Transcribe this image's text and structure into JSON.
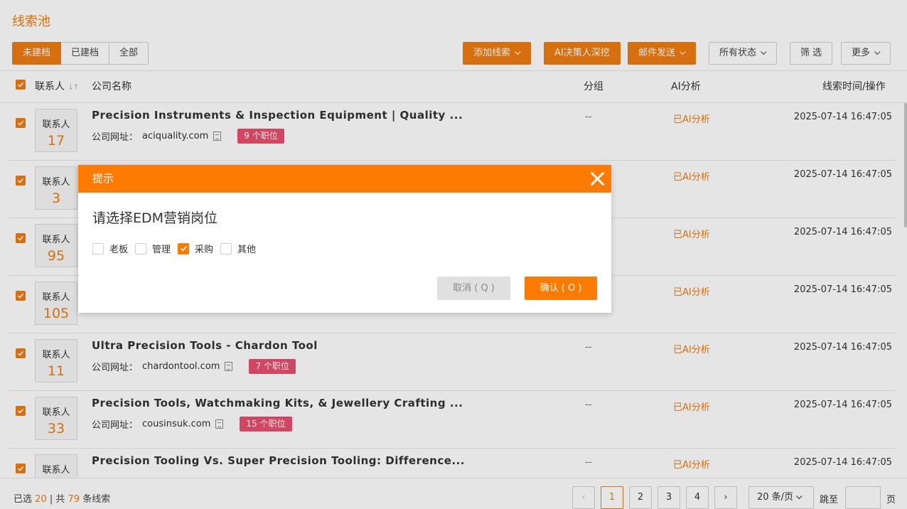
{
  "page": {
    "title": "线索池"
  },
  "tabs": [
    {
      "label": "未建档",
      "active": true
    },
    {
      "label": "已建档",
      "active": false
    },
    {
      "label": "全部",
      "active": false
    }
  ],
  "toolbar": {
    "add_lead": "添加线索",
    "ai_deep": "AI决策人深挖",
    "email_send": "邮件发送",
    "all_status": "所有状态",
    "filter": "筛 选",
    "more": "更多"
  },
  "table": {
    "headers": {
      "contact": "联系人",
      "company": "公司名称",
      "group": "分组",
      "ai": "AI分析",
      "time_op": "线索时间/操作"
    },
    "rows": [
      {
        "contact_label": "联系人",
        "contact_count": "17",
        "name": "Precision Instruments & Inspection Equipment | Quality ...",
        "url_label": "公司网址：",
        "url": "aciquality.com",
        "jobs": "9 个职位",
        "group": "--",
        "ai": "已AI分析",
        "time": "2025-07-14 16:47:05"
      },
      {
        "contact_label": "联系人",
        "contact_count": "3",
        "name": "",
        "url_label": "",
        "url": "",
        "jobs": "",
        "group": "",
        "ai": "已AI分析",
        "time": "2025-07-14 16:47:05"
      },
      {
        "contact_label": "联系人",
        "contact_count": "95",
        "name": "",
        "url_label": "",
        "url": "",
        "jobs": "",
        "group": "",
        "ai": "已AI分析",
        "time": "2025-07-14 16:47:05"
      },
      {
        "contact_label": "联系人",
        "contact_count": "105",
        "name": "",
        "url_label": "",
        "url": "",
        "jobs": "",
        "group": "",
        "ai": "已AI分析",
        "time": "2025-07-14 16:47:05"
      },
      {
        "contact_label": "联系人",
        "contact_count": "11",
        "name": "Ultra Precision Tools - Chardon Tool",
        "url_label": "公司网址：",
        "url": "chardontool.com",
        "jobs": "7 个职位",
        "group": "--",
        "ai": "已AI分析",
        "time": "2025-07-14 16:47:05"
      },
      {
        "contact_label": "联系人",
        "contact_count": "33",
        "name": "Precision Tools, Watchmaking Kits, & Jewellery Crafting ...",
        "url_label": "公司网址：",
        "url": "cousinsuk.com",
        "jobs": "15 个职位",
        "group": "--",
        "ai": "已AI分析",
        "time": "2025-07-14 16:47:05"
      },
      {
        "contact_label": "联系人",
        "contact_count": "",
        "name": "Precision Tooling Vs. Super Precision Tooling: Difference...",
        "url_label": "",
        "url": "",
        "jobs": "",
        "group": "--",
        "ai": "已AI分析",
        "time": "2025-07-14 16:47:05"
      }
    ]
  },
  "footer": {
    "selected_prefix": "已选",
    "selected_count": "20",
    "total_prefix": "| 共",
    "total_count": "79",
    "total_suffix": "条线索",
    "pages": [
      "1",
      "2",
      "3",
      "4"
    ],
    "current_page": "1",
    "page_size": "20 条/页",
    "jump_label": "跳至",
    "page_unit": "页"
  },
  "dialog": {
    "title": "提示",
    "question": "请选择EDM营销岗位",
    "options": [
      {
        "label": "老板",
        "checked": false
      },
      {
        "label": "管理",
        "checked": false
      },
      {
        "label": "采购",
        "checked": true
      },
      {
        "label": "其他",
        "checked": false
      }
    ],
    "cancel": "取消 ( Q )",
    "confirm": "确认 ( O )"
  },
  "colors": {
    "accent": "#f07c10",
    "badge": "#e9506f"
  }
}
